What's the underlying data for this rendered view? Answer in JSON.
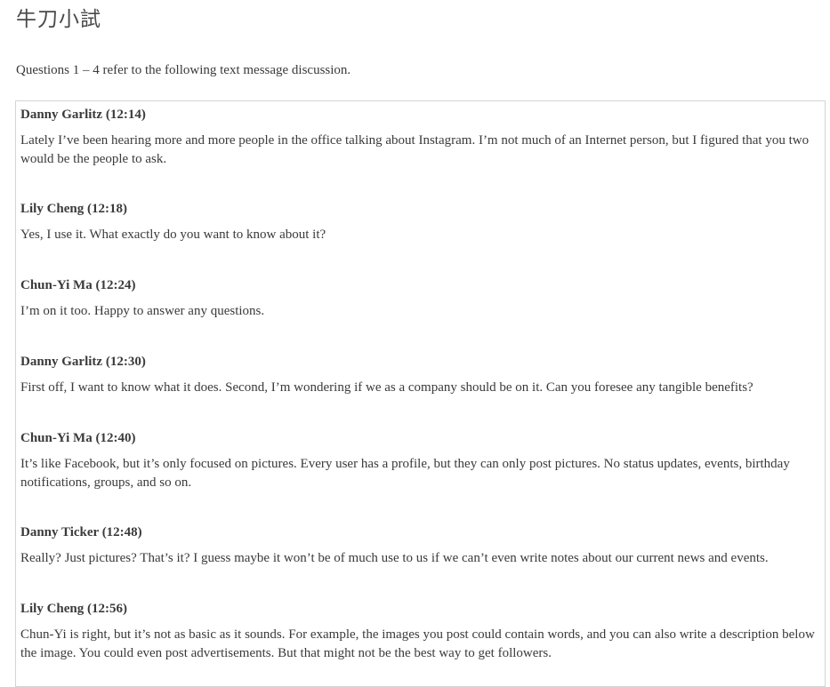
{
  "page": {
    "title": "牛刀小試",
    "intro": "Questions 1 – 4 refer to the following text message discussion."
  },
  "messages": [
    {
      "author": "Danny Garlitz (12:14)",
      "text": "Lately I’ve been hearing more and more people in the office talking about Instagram. I’m not much of an Internet person, but I figured that you two would be the people to ask."
    },
    {
      "author": "Lily Cheng (12:18)",
      "text": "Yes, I use it. What exactly do you want to know about it?"
    },
    {
      "author": "Chun-Yi Ma (12:24)",
      "text": "I’m on it too. Happy to answer any questions."
    },
    {
      "author": "Danny Garlitz (12:30)",
      "text": "First off, I want to know what it does. Second, I’m wondering if we as a company should be on it. Can you foresee any tangible benefits?"
    },
    {
      "author": "Chun-Yi Ma (12:40)",
      "text": "It’s like Facebook, but it’s only focused on pictures. Every user has a profile, but they can only post pictures. No status updates, events, birthday notifications, groups, and so on."
    },
    {
      "author": "Danny Ticker (12:48)",
      "text": "Really? Just pictures? That’s it? I guess maybe it won’t be of much use to us if we can’t even write notes about our current news and events."
    },
    {
      "author": "Lily Cheng (12:56)",
      "text": "Chun-Yi is right, but it’s not as basic as it sounds. For example, the images you post could contain words, and you can also write a description below the image. You could even post advertisements. But that might not be the best way to get followers."
    }
  ]
}
